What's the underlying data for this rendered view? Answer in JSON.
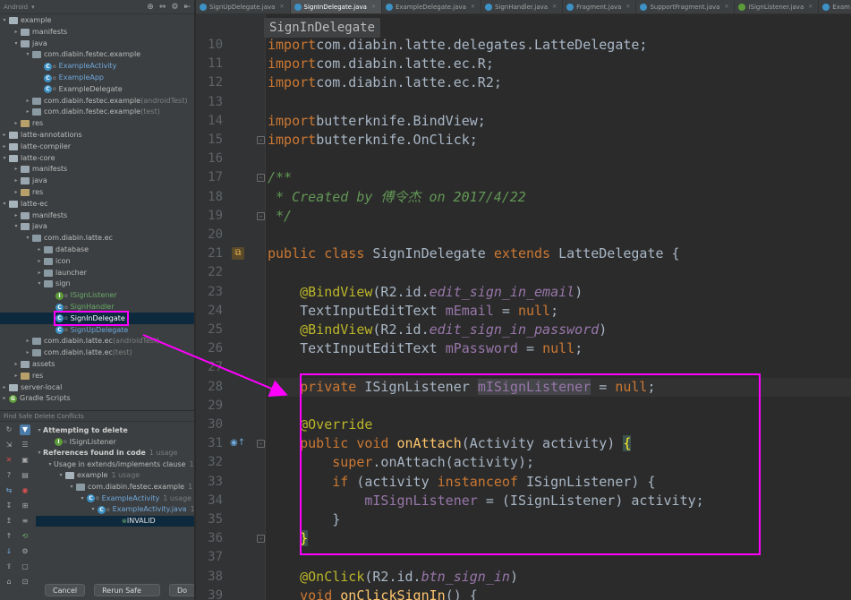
{
  "project_panel": {
    "view_label": "Android",
    "tree": [
      {
        "label": "example",
        "indent": 0,
        "kind": "mod",
        "arrow": "open"
      },
      {
        "label": "manifests",
        "indent": 1,
        "kind": "fold",
        "arrow": "closed"
      },
      {
        "label": "java",
        "indent": 1,
        "kind": "fold",
        "arrow": "open"
      },
      {
        "label": "com.diabin.festec.example",
        "indent": 2,
        "kind": "pkg",
        "arrow": "open"
      },
      {
        "label": "ExampleActivity",
        "indent": 3,
        "kind": "class",
        "color": "blue"
      },
      {
        "label": "ExampleApp",
        "indent": 3,
        "kind": "class",
        "color": "blue"
      },
      {
        "label": "ExampleDelegate",
        "indent": 3,
        "kind": "class"
      },
      {
        "label": "com.diabin.festec.example",
        "suffix": "(androidTest)",
        "indent": 2,
        "kind": "pkg",
        "arrow": "closed"
      },
      {
        "label": "com.diabin.festec.example",
        "suffix": "(test)",
        "indent": 2,
        "kind": "pkg",
        "arrow": "closed"
      },
      {
        "label": "res",
        "indent": 1,
        "kind": "res",
        "arrow": "closed"
      },
      {
        "label": "latte-annotations",
        "indent": 0,
        "kind": "mod",
        "arrow": "closed"
      },
      {
        "label": "latte-compiler",
        "indent": 0,
        "kind": "mod",
        "arrow": "closed"
      },
      {
        "label": "latte-core",
        "indent": 0,
        "kind": "mod",
        "arrow": "open"
      },
      {
        "label": "manifests",
        "indent": 1,
        "kind": "fold",
        "arrow": "closed"
      },
      {
        "label": "java",
        "indent": 1,
        "kind": "fold",
        "arrow": "closed"
      },
      {
        "label": "res",
        "indent": 1,
        "kind": "res",
        "arrow": "closed"
      },
      {
        "label": "latte-ec",
        "indent": 0,
        "kind": "mod",
        "arrow": "open"
      },
      {
        "label": "manifests",
        "indent": 1,
        "kind": "fold",
        "arrow": "closed"
      },
      {
        "label": "java",
        "indent": 1,
        "kind": "fold",
        "arrow": "open"
      },
      {
        "label": "com.diabin.latte.ec",
        "indent": 2,
        "kind": "pkg",
        "arrow": "open"
      },
      {
        "label": "database",
        "indent": 3,
        "kind": "pkg",
        "arrow": "closed"
      },
      {
        "label": "icon",
        "indent": 3,
        "kind": "pkg",
        "arrow": "closed"
      },
      {
        "label": "launcher",
        "indent": 3,
        "kind": "pkg",
        "arrow": "closed"
      },
      {
        "label": "sign",
        "indent": 3,
        "kind": "pkg",
        "arrow": "open"
      },
      {
        "label": "ISignListener",
        "indent": 4,
        "kind": "iface",
        "color": "green"
      },
      {
        "label": "SignHandler",
        "indent": 4,
        "kind": "class",
        "color": "green"
      },
      {
        "label": "SignInDelegate",
        "indent": 4,
        "kind": "class",
        "selected": true
      },
      {
        "label": "SignUpDelegate",
        "indent": 4,
        "kind": "class",
        "color": "blue"
      },
      {
        "label": "com.diabin.latte.ec",
        "suffix": "(androidTest)",
        "indent": 2,
        "kind": "pkg",
        "arrow": "closed"
      },
      {
        "label": "com.diabin.latte.ec",
        "suffix": "(test)",
        "indent": 2,
        "kind": "pkg",
        "arrow": "closed"
      },
      {
        "label": "assets",
        "indent": 1,
        "kind": "fold",
        "arrow": "closed"
      },
      {
        "label": "res",
        "indent": 1,
        "kind": "res",
        "arrow": "closed"
      },
      {
        "label": "server-local",
        "indent": 0,
        "kind": "mod",
        "arrow": "closed"
      },
      {
        "label": "Gradle Scripts",
        "indent": 0,
        "kind": "gradle",
        "arrow": "closed"
      }
    ]
  },
  "conflicts_panel": {
    "title": "Find Safe Delete Conflicts",
    "tree": [
      {
        "label": "Attempting to delete",
        "indent": 0,
        "bold": true,
        "arrow": "open"
      },
      {
        "label": "ISignListener",
        "indent": 1,
        "kind": "iface"
      },
      {
        "label": "References found in code",
        "usage": "1 usage",
        "indent": 0,
        "bold": true,
        "arrow": "open"
      },
      {
        "label": "Usage in extends/implements clause",
        "usage": "1 usage",
        "indent": 1,
        "arrow": "open"
      },
      {
        "label": "example",
        "usage": "1 usage",
        "indent": 2,
        "kind": "mod",
        "arrow": "open"
      },
      {
        "label": "com.diabin.festec.example",
        "usage": "1 usage",
        "indent": 3,
        "kind": "pkg",
        "arrow": "open"
      },
      {
        "label": "ExampleActivity",
        "usage": "1 usage",
        "indent": 4,
        "kind": "class",
        "color": "blue",
        "arrow": "open"
      },
      {
        "label": "ExampleActivity.java",
        "usage": "1 usage",
        "indent": 5,
        "kind": "class",
        "color": "blue",
        "arrow": "open"
      },
      {
        "label": "INVALID",
        "indent": 6,
        "selected": true
      }
    ],
    "buttons": {
      "cancel": "Cancel",
      "rerun": "Rerun Safe Delete",
      "do": "Do"
    }
  },
  "tabs": [
    {
      "label": "SignUpDelegate.java",
      "icon": "blue"
    },
    {
      "label": "SignInDelegate.java",
      "icon": "blue",
      "active": true
    },
    {
      "label": "ExampleDelegate.java",
      "icon": "blue"
    },
    {
      "label": "SignHandler.java",
      "icon": "blue"
    },
    {
      "label": "Fragment.java",
      "icon": "blue"
    },
    {
      "label": "SupportFragment.java",
      "icon": "blue"
    },
    {
      "label": "ISignListener.java",
      "icon": "green"
    },
    {
      "label": "Exam",
      "icon": "blue"
    }
  ],
  "editor": {
    "breadcrumb": "SignInDelegate",
    "line_numbers": [
      "10",
      "11",
      "12",
      "13",
      "14",
      "15",
      "16",
      "17",
      "18",
      "19",
      "20",
      "21",
      "22",
      "23",
      "24",
      "25",
      "26",
      "27",
      "28",
      "29",
      "30",
      "31",
      "32",
      "33",
      "34",
      "35",
      "36",
      "37",
      "38",
      "39"
    ],
    "lines": [
      [
        [
          "kw",
          "import"
        ],
        [
          "",
          "com.diabin.latte.delegates.LatteDelegate;"
        ]
      ],
      [
        [
          "kw",
          "import"
        ],
        [
          "",
          "com.diabin.latte.ec.R;"
        ]
      ],
      [
        [
          "kw",
          "import"
        ],
        [
          "",
          "com.diabin.latte.ec.R2;"
        ]
      ],
      [],
      [
        [
          "kw",
          "import"
        ],
        [
          "",
          "butterknife.BindView;"
        ]
      ],
      [
        [
          "kw",
          "import"
        ],
        [
          "",
          "butterknife.OnClick;"
        ]
      ],
      [],
      [
        [
          "cm",
          "/**"
        ]
      ],
      [
        [
          "cm",
          " * Created by 傅令杰 on 2017/4/22"
        ]
      ],
      [
        [
          "cm",
          " */"
        ]
      ],
      [],
      [
        [
          "kw",
          "public class "
        ],
        [
          "",
          "SignInDelegate "
        ],
        [
          "kw",
          "extends "
        ],
        [
          "",
          "LatteDelegate {"
        ]
      ],
      [],
      [
        [
          "",
          "    "
        ],
        [
          "an",
          "@BindView"
        ],
        [
          "",
          "(R2.id."
        ],
        [
          "it",
          "edit_sign_in_email"
        ],
        [
          "",
          ")"
        ]
      ],
      [
        [
          "",
          "    TextInputEditText "
        ],
        [
          "fld",
          "mEmail"
        ],
        [
          "",
          " = "
        ],
        [
          "kw",
          "null"
        ],
        [
          "",
          ";"
        ]
      ],
      [
        [
          "",
          "    "
        ],
        [
          "an",
          "@BindView"
        ],
        [
          "",
          "(R2.id."
        ],
        [
          "it",
          "edit_sign_in_password"
        ],
        [
          "",
          ")"
        ]
      ],
      [
        [
          "",
          "    TextInputEditText "
        ],
        [
          "fld",
          "mPassword"
        ],
        [
          "",
          " = "
        ],
        [
          "kw",
          "null"
        ],
        [
          "",
          ";"
        ]
      ],
      [],
      [
        [
          "",
          "    "
        ],
        [
          "kw",
          "private "
        ],
        [
          "",
          "ISignListener "
        ],
        [
          "fld unused",
          "mISignListener"
        ],
        [
          "",
          " = "
        ],
        [
          "kw",
          "null"
        ],
        [
          "",
          ";"
        ]
      ],
      [],
      [
        [
          "",
          "    "
        ],
        [
          "an",
          "@Override"
        ]
      ],
      [
        [
          "",
          "    "
        ],
        [
          "kw",
          "public void "
        ],
        [
          "fn",
          "onAttach"
        ],
        [
          "",
          "(Activity activity) "
        ],
        [
          "brm",
          "{"
        ]
      ],
      [
        [
          "",
          "        "
        ],
        [
          "kw",
          "super"
        ],
        [
          "",
          ".onAttach(activity);"
        ]
      ],
      [
        [
          "",
          "        "
        ],
        [
          "kw",
          "if "
        ],
        [
          "",
          "(activity "
        ],
        [
          "kw",
          "instanceof "
        ],
        [
          "",
          "ISignListener) {"
        ]
      ],
      [
        [
          "",
          "            "
        ],
        [
          "fld",
          "mISignListener"
        ],
        [
          "",
          " = (ISignListener) activity;"
        ]
      ],
      [
        [
          "",
          "        }"
        ]
      ],
      [
        [
          "",
          "    "
        ],
        [
          "brm",
          "}"
        ]
      ],
      [],
      [
        [
          "",
          "    "
        ],
        [
          "an",
          "@OnClick"
        ],
        [
          "",
          "(R2.id."
        ],
        [
          "it",
          "btn_sign_in"
        ],
        [
          "",
          ")"
        ]
      ],
      [
        [
          "",
          "    "
        ],
        [
          "kw",
          "void "
        ],
        [
          "fn",
          "onClickSignIn"
        ],
        [
          "",
          "() {"
        ]
      ]
    ]
  }
}
